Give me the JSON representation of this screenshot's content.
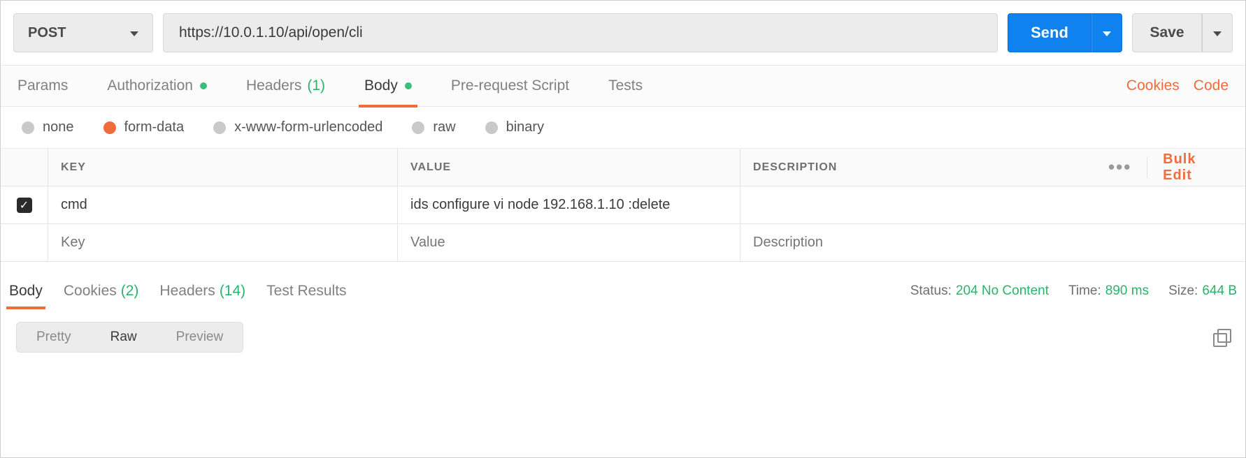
{
  "request": {
    "method": "POST",
    "url": "https://10.0.1.10/api/open/cli",
    "send_label": "Send",
    "save_label": "Save"
  },
  "req_tabs": {
    "params": "Params",
    "authorization": "Authorization",
    "headers": "Headers",
    "headers_count": "(1)",
    "body": "Body",
    "pre_request": "Pre-request Script",
    "tests": "Tests",
    "cookies": "Cookies",
    "code": "Code"
  },
  "body_types": {
    "none": "none",
    "form_data": "form-data",
    "urlencoded": "x-www-form-urlencoded",
    "raw": "raw",
    "binary": "binary"
  },
  "form_data": {
    "headers": {
      "key": "KEY",
      "value": "VALUE",
      "desc": "DESCRIPTION",
      "bulk_edit": "Bulk Edit"
    },
    "rows": [
      {
        "enabled": true,
        "key": "cmd",
        "value": "ids configure vi node 192.168.1.10 :delete",
        "desc": ""
      }
    ],
    "placeholder": {
      "key": "Key",
      "value": "Value",
      "desc": "Description"
    }
  },
  "resp_tabs": {
    "body": "Body",
    "cookies": "Cookies",
    "cookies_count": "(2)",
    "headers": "Headers",
    "headers_count": "(14)",
    "test_results": "Test Results"
  },
  "resp_meta": {
    "status_label": "Status:",
    "status_value": "204 No Content",
    "time_label": "Time:",
    "time_value": "890 ms",
    "size_label": "Size:",
    "size_value": "644 B"
  },
  "resp_view": {
    "pretty": "Pretty",
    "raw": "Raw",
    "preview": "Preview"
  }
}
